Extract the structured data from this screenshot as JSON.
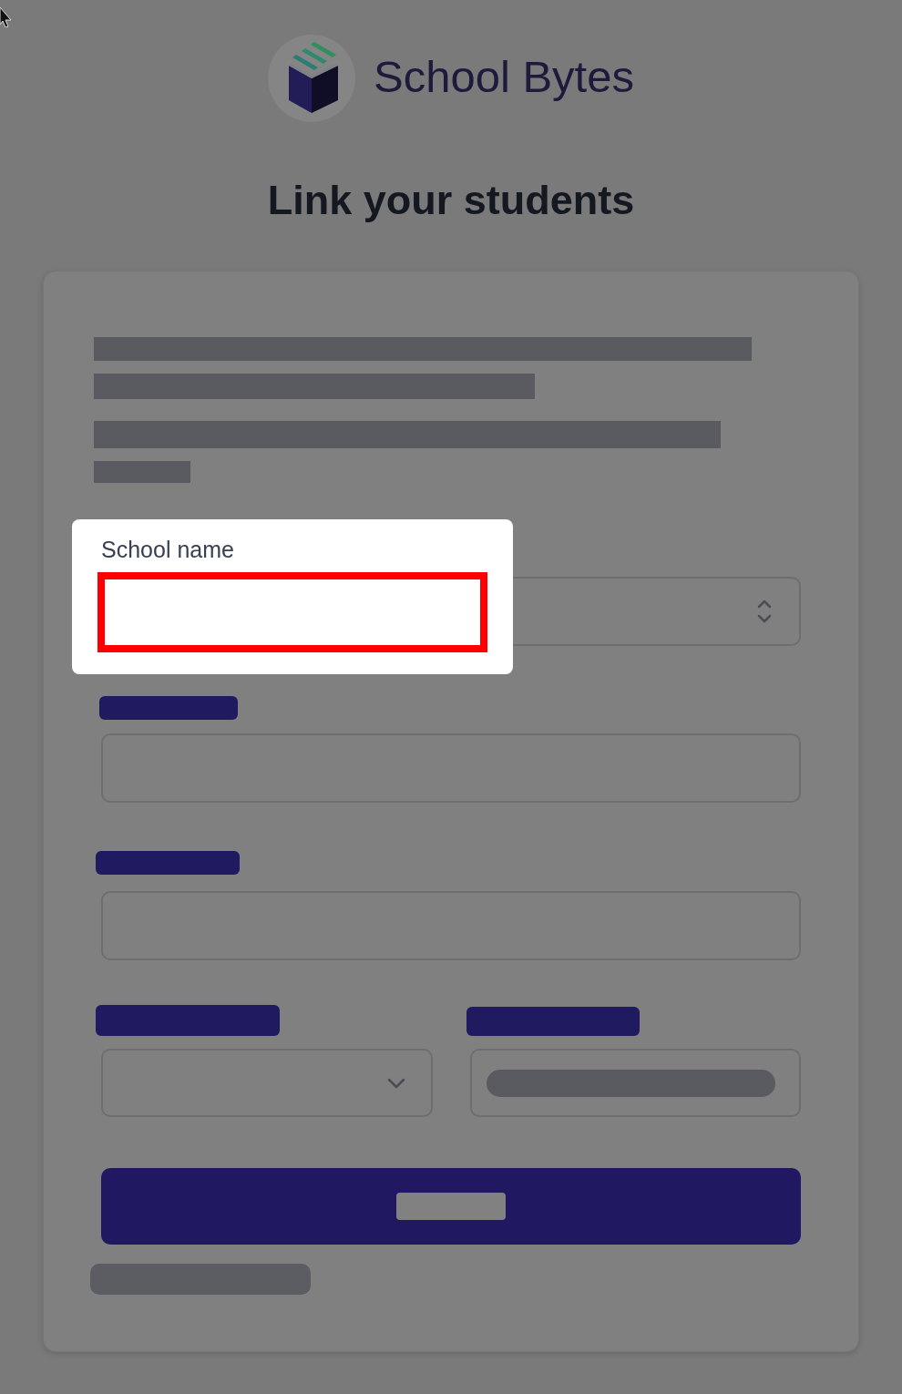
{
  "logo": {
    "text": "School Bytes"
  },
  "heading": "Link your students",
  "form": {
    "fields": [
      {
        "kind": "spinner"
      },
      {
        "kind": "text"
      },
      {
        "kind": "text"
      }
    ],
    "pair": [
      {
        "kind": "dropdown"
      },
      {
        "kind": "redacted"
      }
    ]
  },
  "highlight": {
    "label": "School name",
    "highlighted": true
  }
}
